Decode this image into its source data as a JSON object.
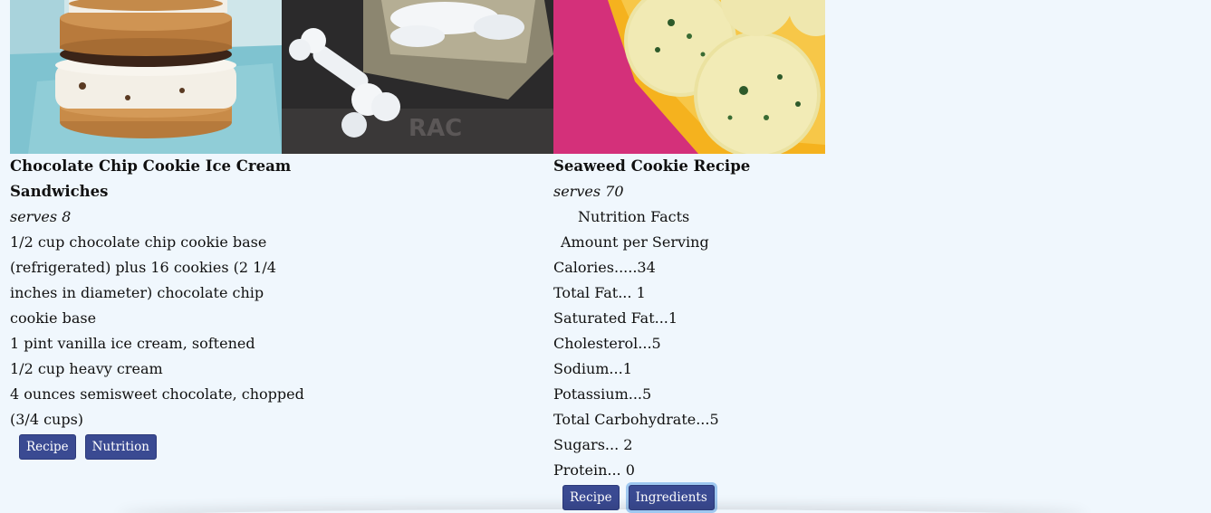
{
  "cards": [
    {
      "title_lines": [
        "Chocolate Chip Cookie Ice Cream",
        "Sandwiches"
      ],
      "serves": "serves 8",
      "body_lines": [
        "1/2 cup chocolate chip cookie base",
        "(refrigerated) plus 16 cookies (2 1/4",
        "inches in diameter) chocolate chip",
        "cookie base",
        "1 pint vanilla ice cream, softened",
        "1/2 cup heavy cream",
        "4 ounces semisweet chocolate, chopped",
        "(3/4 cups)"
      ],
      "buttons": [
        "Recipe",
        "Nutrition"
      ]
    },
    {
      "title_lines": [
        "Seaweed Cookie Recipe"
      ],
      "serves": "serves 70",
      "body_lines": [
        "Nutrition Facts",
        "Amount per Serving",
        "Calories.....34",
        "Total Fat... 1",
        "Saturated Fat...1",
        "Cholesterol...5",
        "Sodium...1",
        "Potassium...5",
        "Total Carbohydrate...5",
        "Sugars... 2",
        "Protein... 0"
      ],
      "buttons": [
        "Recipe",
        "Ingredients"
      ]
    }
  ]
}
